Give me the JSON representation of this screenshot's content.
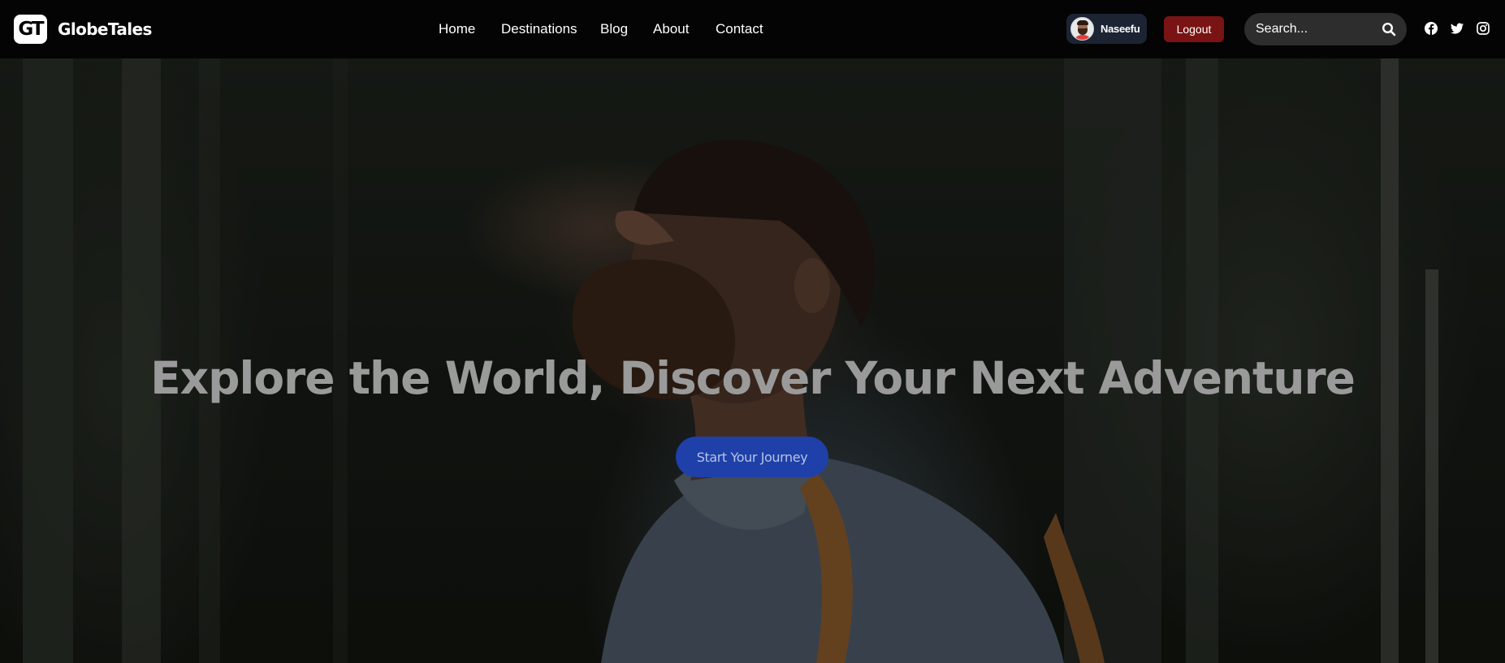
{
  "brand": {
    "logo_text": "GT",
    "name": "GlobeTales"
  },
  "nav": {
    "links": [
      {
        "label": "Home"
      },
      {
        "label": "Destinations"
      },
      {
        "label": "Blog"
      },
      {
        "label": "About"
      },
      {
        "label": "Contact"
      }
    ]
  },
  "user": {
    "name": "Naseefu",
    "logout_label": "Logout"
  },
  "search": {
    "placeholder": "Search...",
    "icon": "search-icon"
  },
  "social": {
    "icons": [
      "facebook-icon",
      "twitter-icon",
      "instagram-icon"
    ]
  },
  "hero": {
    "title": "Explore the World, Discover Your Next Adventure",
    "cta_label": "Start Your Journey"
  },
  "colors": {
    "navbar_bg": "#040404",
    "logout_bg": "#7a1414",
    "cta_bg": "#1e40a8",
    "user_chip_bg": "#1c2333",
    "search_bg": "#2d2d2d"
  }
}
